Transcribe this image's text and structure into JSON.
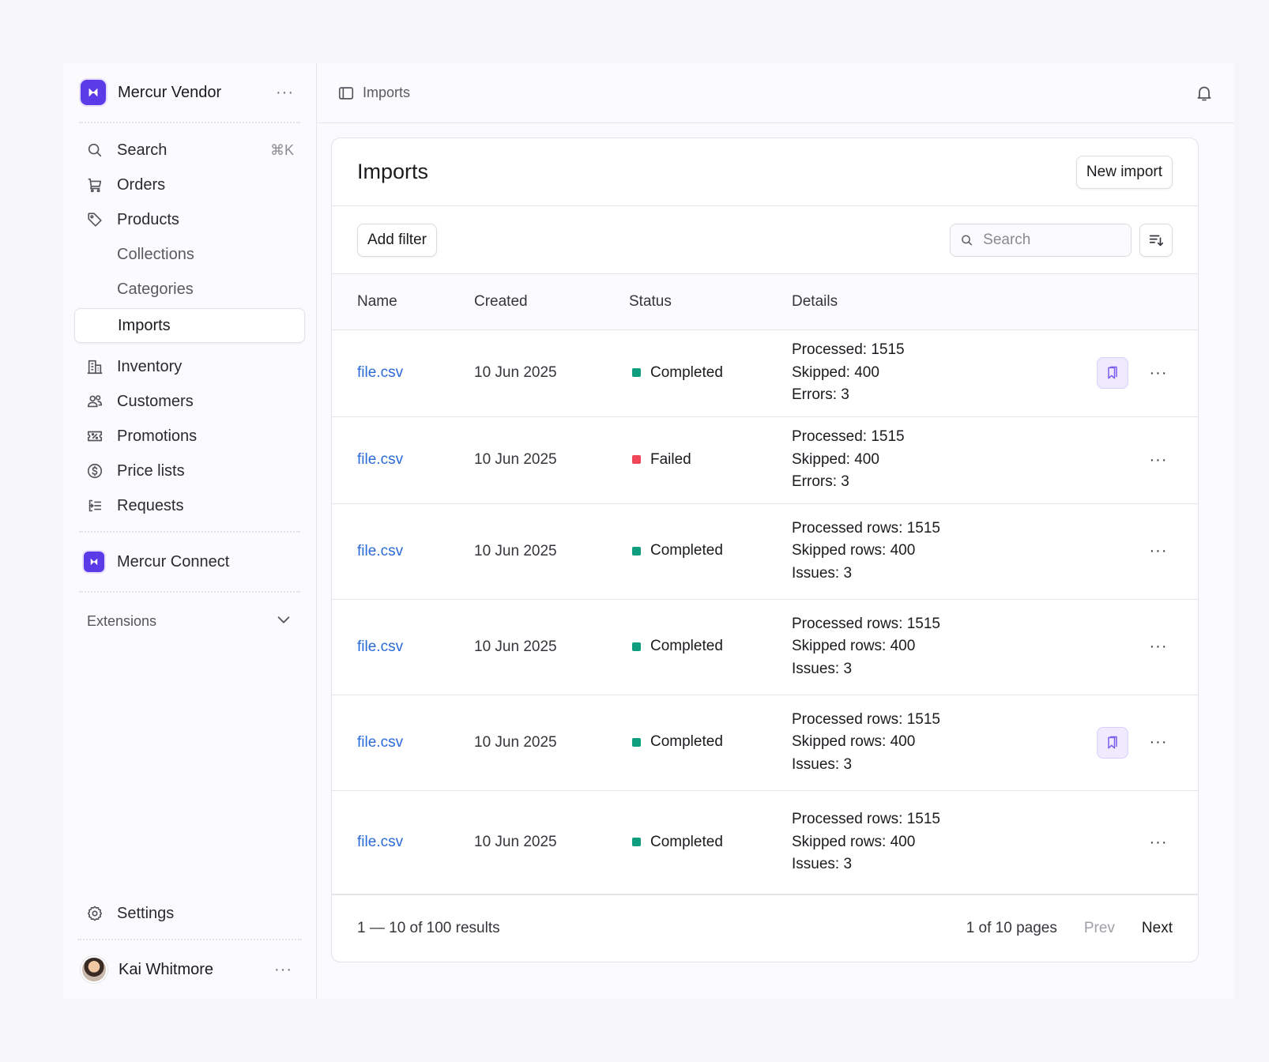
{
  "sidebar": {
    "brand": "Mercur Vendor",
    "menu_dots": "···",
    "nav": [
      {
        "label": "Search",
        "shortcut": "⌘K"
      },
      {
        "label": "Orders"
      },
      {
        "label": "Products"
      },
      {
        "label": "Collections"
      },
      {
        "label": "Categories"
      },
      {
        "label": "Imports"
      },
      {
        "label": "Inventory"
      },
      {
        "label": "Customers"
      },
      {
        "label": "Promotions"
      },
      {
        "label": "Price lists"
      },
      {
        "label": "Requests"
      }
    ],
    "connect": "Mercur Connect",
    "extensions": "Extensions",
    "settings": "Settings",
    "user": "Kai Whitmore"
  },
  "topbar": {
    "breadcrumb": "Imports"
  },
  "card": {
    "title": "Imports",
    "new_button": "New import",
    "filter_button": "Add filter",
    "search_placeholder": "Search"
  },
  "table": {
    "columns": [
      "Name",
      "Created",
      "Status",
      "Details"
    ],
    "rows": [
      {
        "name": "file.csv",
        "created": "10 Jun 2025",
        "status": "Completed",
        "details": [
          "Processed: 1515",
          "Skipped: 400",
          "Errors: 3"
        ],
        "bookmark": true
      },
      {
        "name": "file.csv",
        "created": "10 Jun 2025",
        "status": "Failed",
        "details": [
          "Processed: 1515",
          "Skipped: 400",
          "Errors: 3"
        ],
        "bookmark": false
      },
      {
        "name": "file.csv",
        "created": "10 Jun 2025",
        "status": "Completed",
        "details": [
          "Processed rows: 1515",
          "Skipped rows: 400",
          "Issues: 3"
        ],
        "bookmark": false
      },
      {
        "name": "file.csv",
        "created": "10 Jun 2025",
        "status": "Completed",
        "details": [
          "Processed rows: 1515",
          "Skipped rows: 400",
          "Issues: 3"
        ],
        "bookmark": false
      },
      {
        "name": "file.csv",
        "created": "10 Jun 2025",
        "status": "Completed",
        "details": [
          "Processed rows: 1515",
          "Skipped rows: 400",
          "Issues: 3"
        ],
        "bookmark": true
      },
      {
        "name": "file.csv",
        "created": "10 Jun 2025",
        "status": "Completed",
        "details": [
          "Processed rows: 1515",
          "Skipped rows: 400",
          "Issues: 3"
        ],
        "bookmark": false
      }
    ],
    "row_menu": "···"
  },
  "pagination": {
    "results": "1 — 10 of 100 results",
    "pages": "1 of 10 pages",
    "prev": "Prev",
    "next": "Next"
  },
  "colors": {
    "accent": "#5b3be8",
    "link": "#2a6bd9",
    "status_completed": "#0f9f7f",
    "status_failed": "#ef4757",
    "bookmark_bg": "#efeafd"
  },
  "icons": {
    "brand": "mercur-logo-icon",
    "search": "search-icon",
    "orders": "shopping-cart-icon",
    "products": "tag-icon",
    "inventory": "building-icon",
    "customers": "users-icon",
    "promotions": "receipt-percent-icon",
    "price_lists": "currency-dollar-icon",
    "requests": "request-list-icon",
    "settings": "gear-icon",
    "sidebar_toggle": "sidebar-panel-icon",
    "notifications": "bell-icon",
    "sort": "sort-descending-icon",
    "bookmark": "bookmarks-icon"
  }
}
